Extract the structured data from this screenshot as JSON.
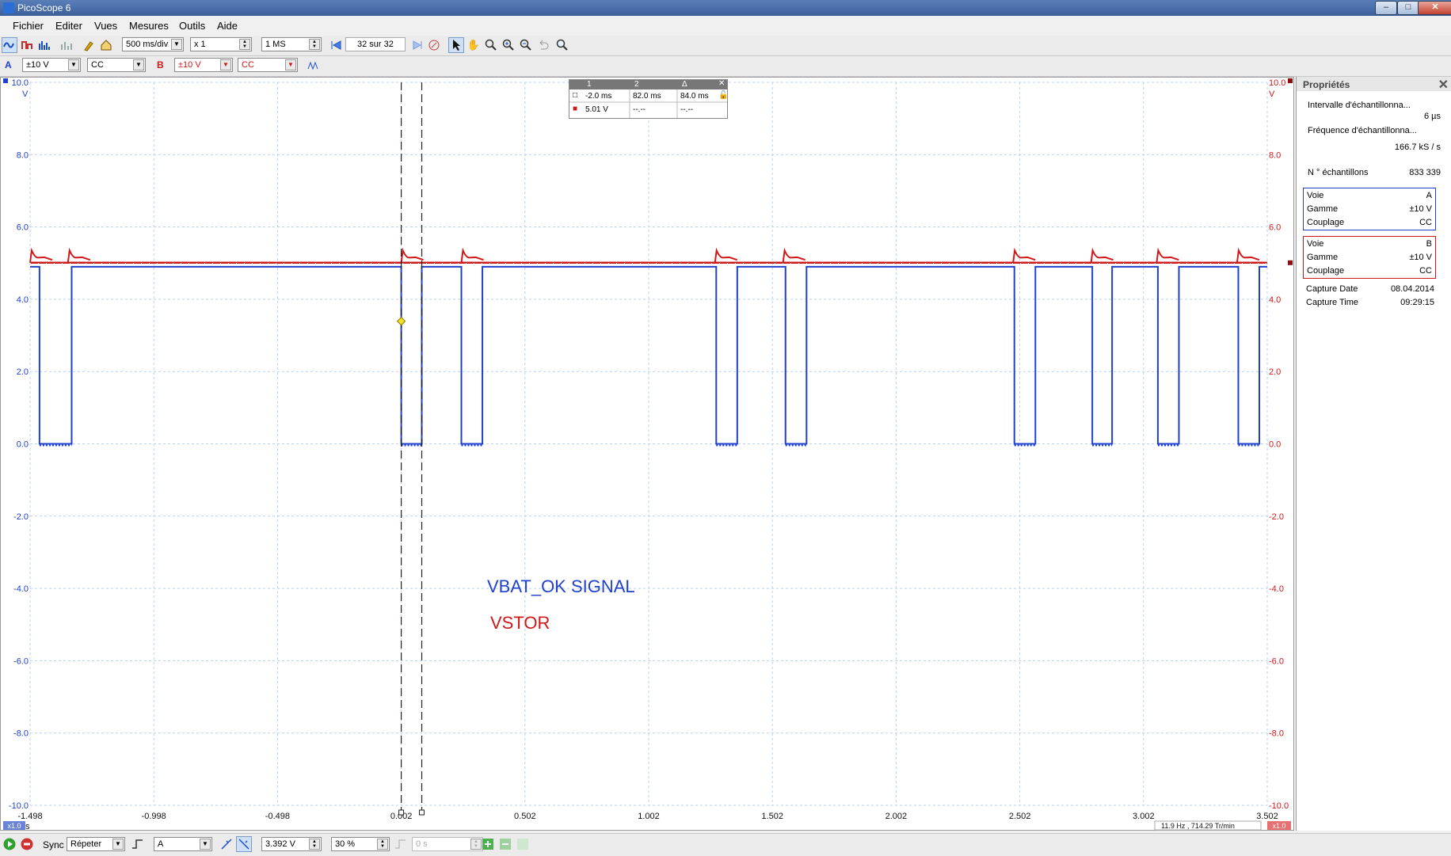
{
  "window": {
    "title": "PicoScope 6",
    "min": "–",
    "max": "□",
    "close": "✕"
  },
  "menu": [
    "Fichier",
    "Editer",
    "Vues",
    "Mesures",
    "Outils",
    "Aide"
  ],
  "toolbar": {
    "timebase": "500 ms/div",
    "zoom": "x 1",
    "samples": "1 MS",
    "buffer": "32 sur 32"
  },
  "channels": {
    "a": {
      "label": "A",
      "range": "±10 V",
      "coupling": "CC",
      "color": "#2040d0"
    },
    "b": {
      "label": "B",
      "range": "±10 V",
      "coupling": "CC",
      "color": "#d01818"
    }
  },
  "chart_data": {
    "type": "line",
    "xlabel": "s",
    "ylabel_left": "V",
    "ylabel_right": "V",
    "xlim": [
      -1.498,
      3.502
    ],
    "ylim": [
      -10.0,
      10.0
    ],
    "x_ticks": [
      "-1.498",
      "-0.998",
      "-0.498",
      "0.002",
      "0.502",
      "1.002",
      "1.502",
      "2.002",
      "2.502",
      "3.002",
      "3.502"
    ],
    "y_ticks": [
      "10.0",
      "8.0",
      "6.0",
      "4.0",
      "2.0",
      "0.0",
      "-2.0",
      "-4.0",
      "-6.0",
      "-8.0",
      "-10.0"
    ],
    "grid": true,
    "series": [
      {
        "name": "VBAT_OK SIGNAL",
        "color": "#2040d0",
        "high": 4.9,
        "low": 0.0,
        "low_pulses": [
          [
            -1.46,
            -1.33
          ],
          [
            0.002,
            0.085
          ],
          [
            0.245,
            0.33
          ],
          [
            1.275,
            1.36
          ],
          [
            1.555,
            1.64
          ],
          [
            2.48,
            2.565
          ],
          [
            2.795,
            2.875
          ],
          [
            3.06,
            3.145
          ],
          [
            3.385,
            3.47
          ]
        ]
      },
      {
        "name": "VSTOR",
        "color": "#d01818",
        "baseline": 5.01,
        "spikes": [
          -1.498,
          -1.345,
          0.002,
          0.245,
          1.27,
          1.545,
          2.475,
          2.79,
          3.055,
          3.38
        ],
        "spike_peak": 5.35
      }
    ],
    "cursors": {
      "t1": "0.002",
      "t2": "0.085"
    },
    "trigger_level": 3.392
  },
  "measure_table": {
    "headers": [
      "1",
      "2",
      "Δ"
    ],
    "row_time": [
      "-2.0 ms",
      "82.0 ms",
      "84.0 ms"
    ],
    "row_volt": [
      "5.01 V",
      "--.--",
      "--.--"
    ]
  },
  "plot_labels": {
    "left_unit": "V",
    "right_unit": "V",
    "x_unit": "s",
    "scale_left": "x1.0",
    "scale_right": "x1.0",
    "freq": "11.9 Hz , 714.29 Tr/min"
  },
  "annotations": {
    "a": "VBAT_OK SIGNAL",
    "b": "VSTOR"
  },
  "properties": {
    "title": "Propriétés",
    "sample_interval_label": "Intervalle d'échantillonna...",
    "sample_interval": "6 µs",
    "sample_rate_label": "Fréquence d'échantillonna...",
    "sample_rate": "166.7 kS / s",
    "num_samples_label": "N ° échantillons",
    "num_samples": "833 339",
    "ch_a": {
      "voie": "A",
      "gamme": "±10 V",
      "couplage": "CC"
    },
    "ch_b": {
      "voie": "B",
      "gamme": "±10 V",
      "couplage": "CC"
    },
    "voie_label": "Voie",
    "gamme_label": "Gamme",
    "couplage_label": "Couplage",
    "capture_date_label": "Capture Date",
    "capture_date": "08.04.2014",
    "capture_time_label": "Capture Time",
    "capture_time": "09:29:15"
  },
  "statusbar": {
    "sync": "Sync",
    "mode": "Répeter",
    "source": "A",
    "level": "3.392 V",
    "pretrigger": "30 %",
    "delay": "0 s"
  }
}
